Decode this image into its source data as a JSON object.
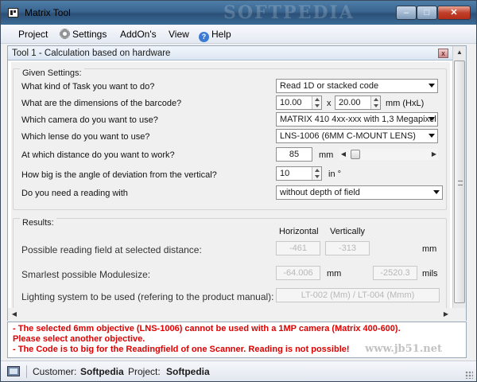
{
  "window": {
    "title": "Matrix Tool",
    "watermark": "SOFTPEDIA",
    "controls": {
      "minimize": "–",
      "maximize": "□",
      "close": "✕"
    }
  },
  "menu": {
    "items": [
      {
        "label": "Project"
      },
      {
        "label": "Settings",
        "icon": "gear-icon"
      },
      {
        "label": "AddOn's"
      },
      {
        "label": "View"
      },
      {
        "label": "Help",
        "icon": "help-icon"
      }
    ]
  },
  "tool": {
    "title": "Tool 1 - Calculation based on hardware",
    "given": {
      "legend": "Given Settings:",
      "task_label": "What kind of Task you want to do?",
      "task_value": "Read 1D or stacked code",
      "dims_label": "What are the dimensions of the barcode?",
      "dims_h": "10.00",
      "dims_x": "x",
      "dims_l": "20.00",
      "dims_unit": "mm (HxL)",
      "camera_label": "Which camera do you want to use?",
      "camera_value": "MATRIX 410 4xx-xxx with 1,3 Megapixel",
      "lense_label": "Which lense do you want to use?",
      "lense_value": "LNS-1006  (6MM C-MOUNT LENS)",
      "distance_label": "At which distance do you want to work?",
      "distance_value": "85",
      "distance_unit": "mm",
      "angle_label": "How big is the angle of deviation from the vertical?",
      "angle_value": "10",
      "angle_unit": "in °",
      "reading_label": "Do you need a reading with",
      "reading_value": "without depth of field"
    },
    "results": {
      "legend": "Results:",
      "col_horizontal": "Horizontal",
      "col_vertical": "Vertically",
      "field_label": "Possible reading field at selected distance:",
      "field_h": "-461",
      "field_v": "-313",
      "field_unit": "mm",
      "module_label": "Smarlest possible Modulesize:",
      "module_mm": "-64.006",
      "module_mm_unit": "mm",
      "module_mils": "-2520.3",
      "module_mils_unit": "mils",
      "lighting_label": "Lighting system to be used (refering to the product manual):",
      "lighting_value": "LT-002 (Mm) / LT-004 (Mmm)"
    }
  },
  "messages": [
    "- The selected 6mm objective (LNS-1006) cannot be used with a 1MP camera (Matrix 400-600).",
    "Please select another objective.",
    "- The Code is to big for the Readingfield of one Scanner. Reading is not possible!"
  ],
  "messages_watermark": "www.jb51.net",
  "status": {
    "customer_label": "Customer:",
    "customer_value": "Softpedia",
    "project_label": "Project:",
    "project_value": "Softpedia"
  },
  "colors": {
    "error": "#e00000",
    "title_bar": "#3a6690"
  }
}
